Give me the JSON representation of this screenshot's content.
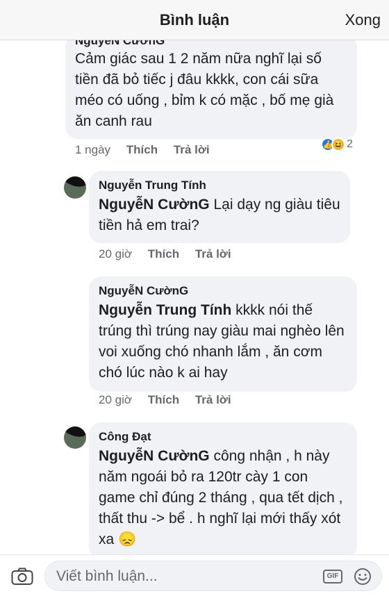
{
  "header": {
    "title": "Bình luận",
    "done_label": "Xong"
  },
  "comments": [
    {
      "author": "NguyễN CườnG",
      "text": "Cảm giác sau 1 2 năm nữa nghĩ lại số tiền đã bỏ tiếc j đâu kkkk, con cái sữa méo có uống , bỉm k có mặc , bố mẹ già ăn canh rau",
      "time": "1 ngày",
      "like_label": "Thích",
      "reply_label": "Trả lời",
      "reaction_count": "2"
    },
    {
      "author": "Nguyễn Trung Tính",
      "mention": "NguyễN CườnG",
      "text": "Lại dạy ng giàu tiêu tiền hả em trai?",
      "time": "20 giờ",
      "like_label": "Thích",
      "reply_label": "Trả lời"
    },
    {
      "author": "NguyễN CườnG",
      "mention": "Nguyễn Trung Tính",
      "text": "kkkk nói thế trúng thì trúng nay giàu mai nghèo lên voi xuống chó nhanh lắm , ăn cơm chó lúc nào k ai hay",
      "time": "20 giờ",
      "like_label": "Thích",
      "reply_label": "Trả lời"
    },
    {
      "author": "Công Đạt",
      "mention": "NguyễN CườnG",
      "text": "công nhận , h này năm ngoái bỏ ra 120tr cày 1 con game chỉ đúng 2 tháng , qua tết dịch , thất thu -> bể . h nghĩ lại mới thấy xót xa 😞"
    }
  ],
  "footer": {
    "placeholder": "Viết bình luận...",
    "gif_label": "GIF"
  },
  "icons": {
    "camera": "camera-icon",
    "gif": "gif-icon",
    "emoji": "emoji-icon",
    "like": "like-reaction-icon",
    "haha": "haha-reaction-icon"
  },
  "colors": {
    "bubble": "#f0f2f5",
    "meta": "#65676b",
    "like_blue": "#1877f2"
  }
}
